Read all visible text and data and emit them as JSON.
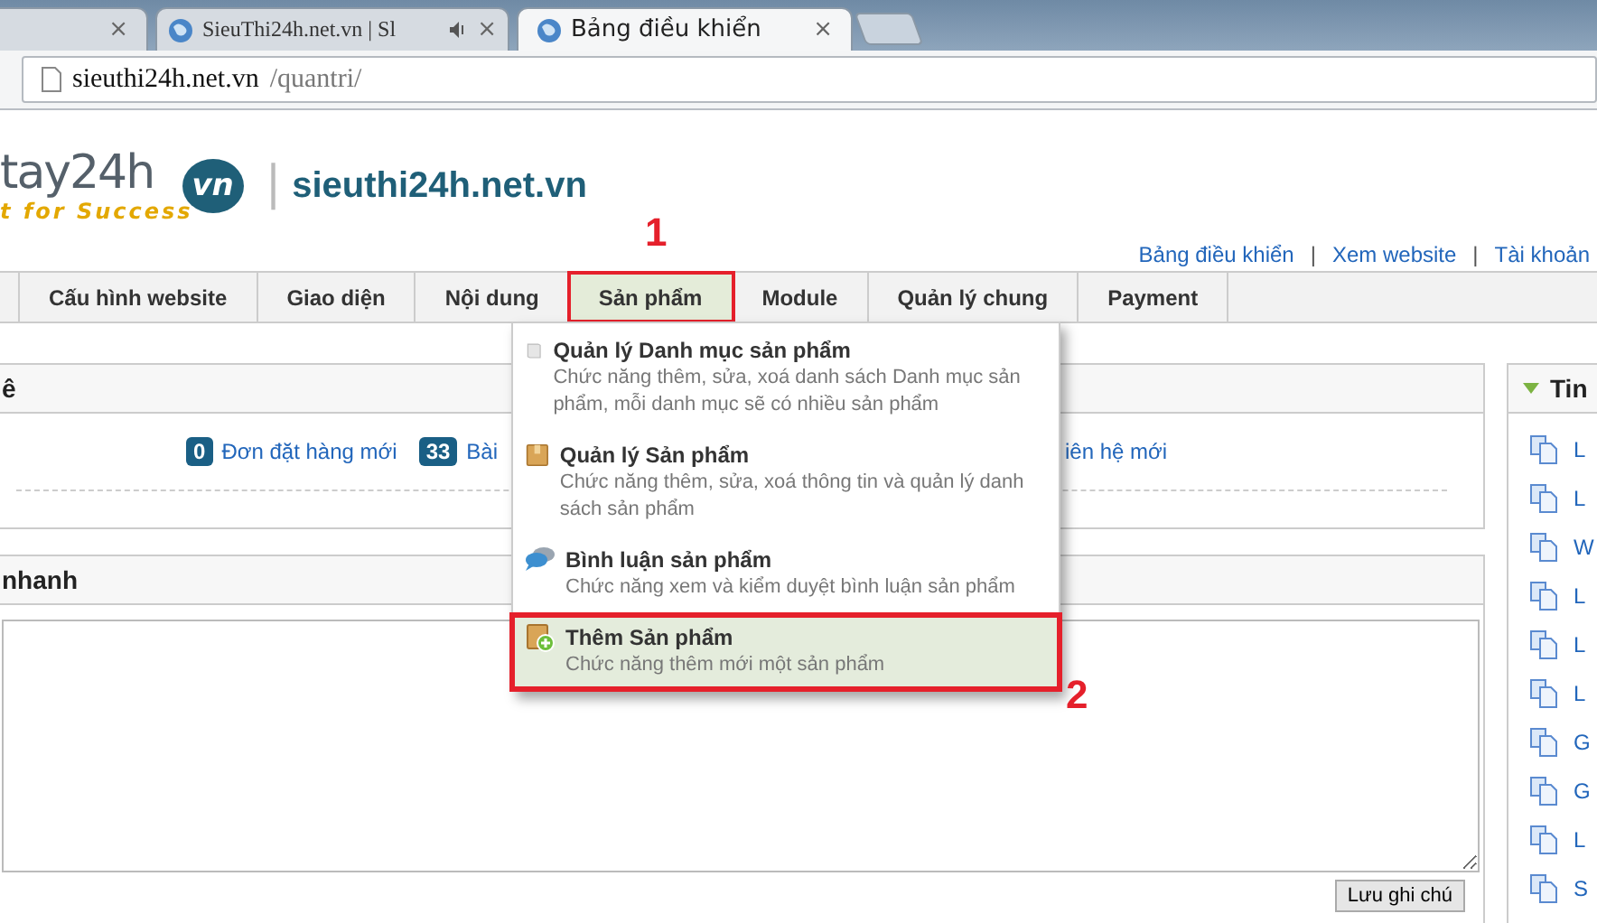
{
  "browser": {
    "tabs": [
      {
        "selected": false,
        "audio": false
      },
      {
        "title": "SieuThi24h.net.vn | Sl",
        "selected": false,
        "audio": true
      },
      {
        "title": "Bảng điều khiển",
        "selected": true,
        "audio": false
      }
    ],
    "close_glyph": "×",
    "url_host": "sieuthi24h.net.vn",
    "url_path": "/quantri/"
  },
  "header": {
    "logo_text": "tay24h",
    "logo_badge": "vn",
    "tagline": "t for Success",
    "site_name": "sieuthi24h.net.vn",
    "top_links": [
      "Bảng điều khiển",
      "Xem website",
      "Tài khoản"
    ],
    "separator": "|"
  },
  "nav": [
    {
      "label": "Cấu hình website",
      "selected": false
    },
    {
      "label": "Giao diện",
      "selected": false
    },
    {
      "label": "Nội dung",
      "selected": false
    },
    {
      "label": "Sản phẩm",
      "selected": true
    },
    {
      "label": "Module",
      "selected": false
    },
    {
      "label": "Quản lý chung",
      "selected": false
    },
    {
      "label": "Payment",
      "selected": false
    }
  ],
  "stats_panel": {
    "title": "ê",
    "stats": [
      {
        "count": "0",
        "label": "Đơn đặt hàng mới"
      },
      {
        "count": "33",
        "label": "Bài"
      },
      {
        "label": "iên hệ mới"
      }
    ]
  },
  "notes_panel": {
    "title": "nhanh",
    "save_button": "Lưu ghi chú"
  },
  "news_panel": {
    "title": "Tin",
    "items": [
      "L",
      "L",
      "W",
      "L",
      "L",
      "L",
      "G",
      "G",
      "L",
      "S"
    ]
  },
  "dropdown": [
    {
      "kind": "category",
      "title": "Quản lý Danh mục sản phẩm",
      "description": "Chức năng thêm, sửa, xoá danh sách Danh mục sản phẩm, mỗi danh mục sẽ có nhiều sản phẩm",
      "selected": false
    },
    {
      "kind": "product",
      "title": "Quản lý Sản phẩm",
      "description": "Chức năng thêm, sửa, xoá thông tin và quản lý danh sách sản phẩm",
      "selected": false
    },
    {
      "kind": "comment",
      "title": "Bình luận sản phẩm",
      "description": "Chức năng xem và kiểm duyệt bình luận sản phẩm",
      "selected": false
    },
    {
      "kind": "add",
      "title": "Thêm Sản phẩm",
      "description": "Chức năng thêm mới một sản phẩm",
      "selected": true
    }
  ],
  "annotations": [
    "1",
    "2"
  ]
}
